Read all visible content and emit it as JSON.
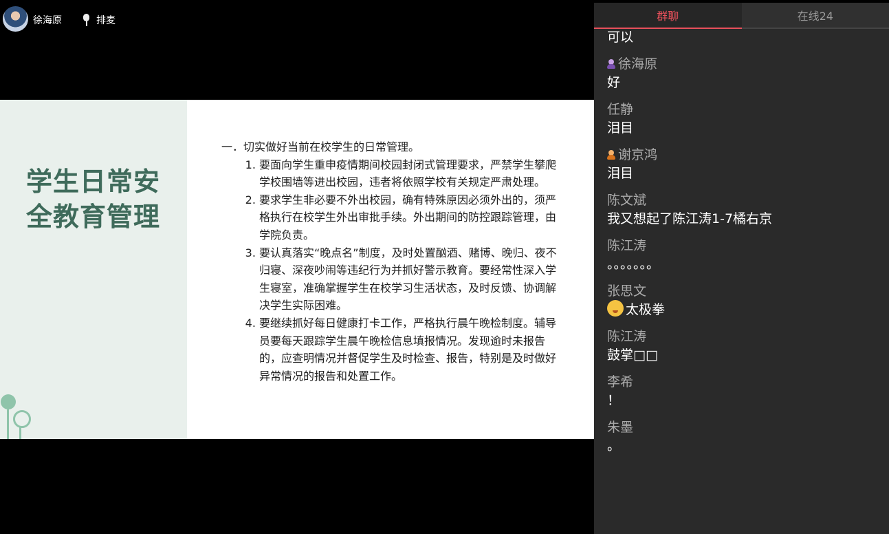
{
  "host": {
    "name": "徐海原"
  },
  "queue_button": {
    "label": "排麦"
  },
  "slide": {
    "title": "学生日常安全教育管理",
    "heading": "一．切实做好当前在校学生的日常管理。",
    "items": [
      {
        "num": "1.",
        "text": "要面向学生重申疫情期间校园封闭式管理要求，严禁学生攀爬学校围墙等进出校园，违者将依照学校有关规定严肃处理。"
      },
      {
        "num": "2.",
        "text": "要求学生非必要不外出校园，确有特殊原因必须外出的，须严格执行在校学生外出审批手续。外出期间的防控跟踪管理，由学院负责。"
      },
      {
        "num": "3.",
        "text": "要认真落实“晚点名”制度，及时处置酗酒、赌博、晚归、夜不归寝、深夜吵闹等违纪行为并抓好警示教育。要经常性深入学生寝室，准确掌握学生在校学习生活状态，及时反馈、协调解决学生实际困难。"
      },
      {
        "num": "4.",
        "text": "要继续抓好每日健康打卡工作，严格执行晨午晚检制度。辅导员要每天跟踪学生晨午晚检信息填报情况。发现逾时未报告的，应查明情况并督促学生及时检查、报告，特别是及时做好异常情况的报告和处置工作。"
      }
    ]
  },
  "chat": {
    "tabs": {
      "group": "群聊",
      "online": "在线24"
    },
    "messages": [
      {
        "sender": "",
        "content": "可以",
        "badge": ""
      },
      {
        "sender": "徐海原",
        "content": "好",
        "badge": "purple"
      },
      {
        "sender": "任静",
        "content": "泪目",
        "badge": ""
      },
      {
        "sender": "谢京鸿",
        "content": "泪目",
        "badge": "orange"
      },
      {
        "sender": "陈文斌",
        "content": "我又想起了陈江涛1-7橘右京",
        "badge": ""
      },
      {
        "sender": "陈江涛",
        "content": "。。。。。。。",
        "badge": ""
      },
      {
        "sender": "张思文",
        "content": "太极拳",
        "badge": "",
        "emoji": "smirk-emoji"
      },
      {
        "sender": "陈江涛",
        "content": "鼓掌□□",
        "badge": ""
      },
      {
        "sender": "李希",
        "content": "！",
        "badge": ""
      },
      {
        "sender": "朱墨",
        "content": "。",
        "badge": ""
      }
    ]
  },
  "colors": {
    "accent": "#e8505b",
    "slide_title": "#3f6b5b",
    "slide_panel": "#e9f0ec",
    "chat_bg": "#2a2a2a"
  }
}
